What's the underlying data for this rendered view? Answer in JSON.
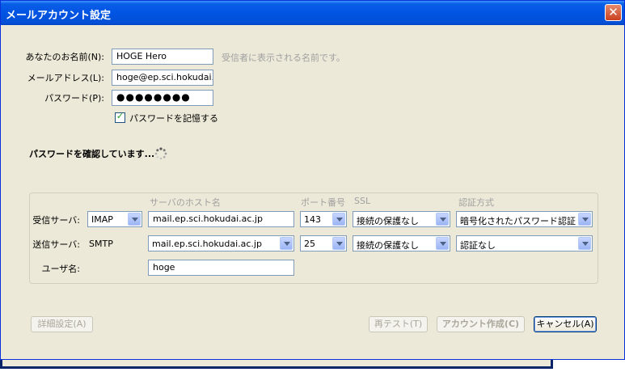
{
  "window": {
    "title": "メールアカウント設定"
  },
  "identity": {
    "name_label": "あなたのお名前(N):",
    "name_value": "HOGE Hero",
    "name_hint": "受信者に表示される名前です。",
    "email_label": "メールアドレス(L):",
    "email_value": "hoge@ep.sci.hokudai.ac.",
    "password_label": "パスワード(P):",
    "password_value": "●●●●●●●●",
    "remember_label": "パスワードを記憶する",
    "remember_checked": true
  },
  "status": {
    "text": "パスワードを確認しています..."
  },
  "server_table": {
    "headers": {
      "host": "サーバのホスト名",
      "port": "ポート番号",
      "ssl": "SSL",
      "auth": "認証方式"
    },
    "incoming": {
      "label": "受信サーバ:",
      "protocol": "IMAP",
      "host": "mail.ep.sci.hokudai.ac.jp",
      "port": "143",
      "ssl": "接続の保護なし",
      "auth": "暗号化されたパスワード認証"
    },
    "outgoing": {
      "label": "送信サーバ:",
      "protocol": "SMTP",
      "host": "mail.ep.sci.hokudai.ac.jp",
      "port": "25",
      "ssl": "接続の保護なし",
      "auth": "認証なし"
    },
    "username": {
      "label": "ユーザ名:",
      "value": "hoge"
    }
  },
  "buttons": {
    "advanced": "詳細設定(A)",
    "retest": "再テスト(T)",
    "create": "アカウント作成(C)",
    "cancel": "キャンセル(A)"
  },
  "colors": {
    "titlebar": "#0054e3",
    "dialog": "#ece9d8",
    "accent_check": "#21a121"
  },
  "icons": {
    "close": "close-icon",
    "spinner": "loading-spinner-icon"
  }
}
